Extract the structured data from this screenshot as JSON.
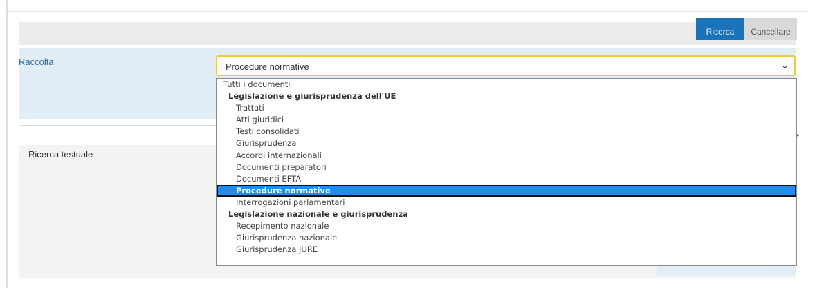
{
  "toolbar": {
    "search_label": "Ricerca",
    "cancel_label": "Cancellare"
  },
  "raccolta": {
    "label": "Raccolta",
    "selected_value": "Procedure normative"
  },
  "dropdown": {
    "options": [
      {
        "label": "Tutti i documenti",
        "kind": "top"
      },
      {
        "label": "Legislazione e giurisprudenza dell'UE",
        "kind": "group"
      },
      {
        "label": "Trattati",
        "kind": "item"
      },
      {
        "label": "Atti giuridici",
        "kind": "item"
      },
      {
        "label": "Testi consolidati",
        "kind": "item"
      },
      {
        "label": "Giurisprudenza",
        "kind": "item"
      },
      {
        "label": "Accordi internazionali",
        "kind": "item"
      },
      {
        "label": "Documenti preparatori",
        "kind": "item"
      },
      {
        "label": "Documenti EFTA",
        "kind": "item"
      },
      {
        "label": "Procedure normative",
        "kind": "item",
        "selected": true
      },
      {
        "label": "Interrogazioni parlamentari",
        "kind": "item"
      },
      {
        "label": "Legislazione nazionale e giurisprudenza",
        "kind": "group"
      },
      {
        "label": "Recepimento nazionale",
        "kind": "item"
      },
      {
        "label": "Giurisprudenza nazionale",
        "kind": "item"
      },
      {
        "label": "Giurisprudenza JURE",
        "kind": "item"
      }
    ]
  },
  "text_search": {
    "label": "Ricerca testuale"
  },
  "colors": {
    "accent": "#1a73b8",
    "select_border": "#f0cc3a",
    "highlight": "#1e8cf0",
    "panel_blue": "#e1eef8"
  },
  "icons": {
    "dropdown": "chevron-down-icon",
    "section_toggle": "caret-icon"
  }
}
